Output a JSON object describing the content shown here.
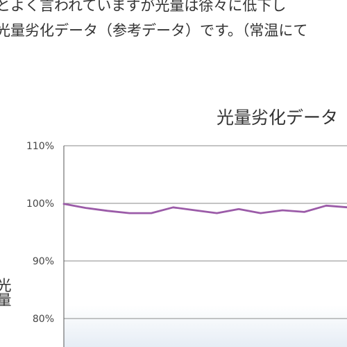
{
  "intro": {
    "line1": "とよく言われていますが光量は徐々に低下し",
    "line2": "光量劣化データ（参考データ）です。（常温にて"
  },
  "chart_data": {
    "type": "line",
    "title": "光量劣化データ",
    "ylabel": "光量",
    "ylim": [
      75,
      110
    ],
    "yticks": [
      80,
      90,
      100,
      110
    ],
    "ytick_labels": [
      "80%",
      "90%",
      "100%",
      "110%"
    ],
    "grid": true,
    "series": [
      {
        "color": "#9b5ba8",
        "values": [
          99.9,
          99.2,
          98.7,
          98.3,
          98.3,
          99.3,
          98.8,
          98.3,
          99.0,
          98.3,
          98.8,
          98.5,
          99.6,
          99.3
        ]
      }
    ]
  }
}
